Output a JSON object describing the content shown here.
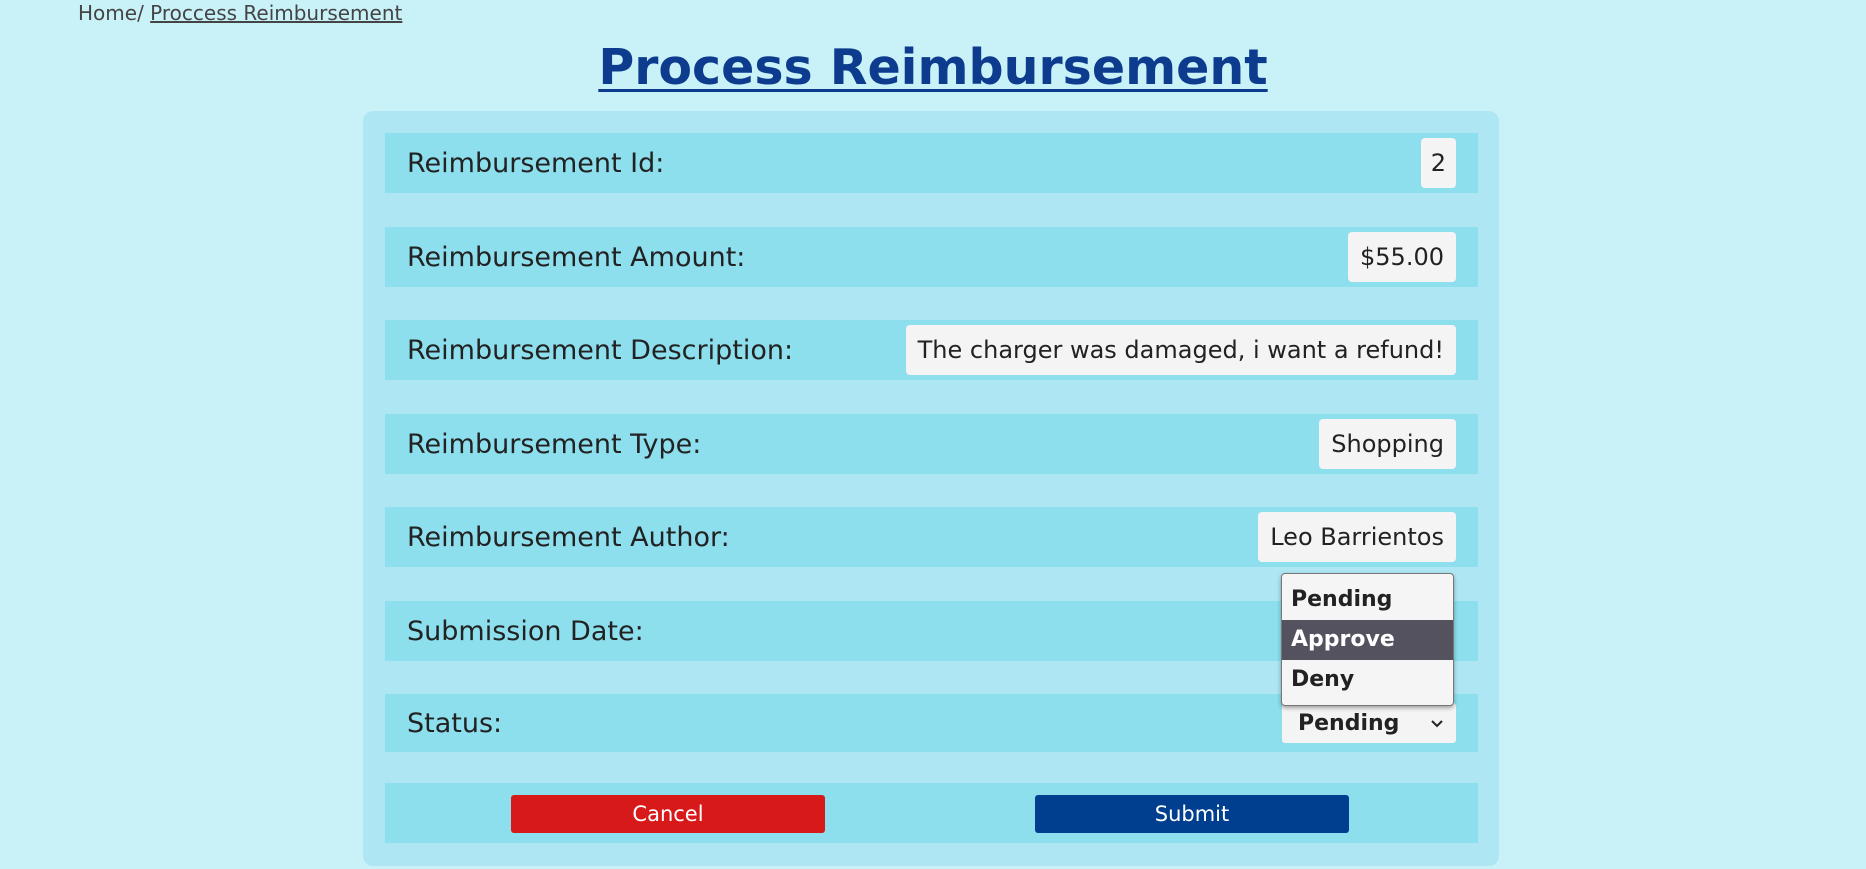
{
  "breadcrumb": {
    "home": "Home/",
    "current": "Proccess Reimbursement"
  },
  "page_title": "Process Reimbursement",
  "fields": {
    "id": {
      "label": "Reimbursement Id:",
      "value": "2"
    },
    "amount": {
      "label": "Reimbursement Amount:",
      "value": "$55.00"
    },
    "description": {
      "label": "Reimbursement Description:",
      "value": "The charger was damaged, i want a refund!"
    },
    "type": {
      "label": "Reimbursement Type:",
      "value": "Shopping"
    },
    "author": {
      "label": "Reimbursement Author:",
      "value": "Leo Barrientos"
    },
    "submission_date": {
      "label": "Submission Date:",
      "value": ""
    },
    "status": {
      "label": "Status:",
      "selected": "Pending",
      "options": [
        "Pending",
        "Approve",
        "Deny"
      ],
      "highlighted": "Approve"
    }
  },
  "buttons": {
    "cancel": "Cancel",
    "submit": "Submit"
  },
  "colors": {
    "page_bg": "#c9f1f8",
    "card_bg": "#aee7f3",
    "row_bg": "#8ddfee",
    "title": "#0d3b8e",
    "cancel": "#d8191a",
    "submit": "#003e8f",
    "option_highlight": "#53525e"
  },
  "icons": {
    "select_arrow": "chevron-down-icon"
  }
}
